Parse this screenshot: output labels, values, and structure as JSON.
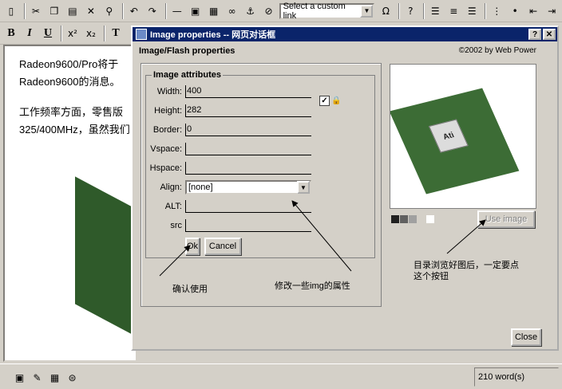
{
  "toolbar1": {
    "link_select_value": "Select a custom link",
    "icons": [
      "new-document-icon",
      "cut-icon",
      "copy-icon",
      "paste-icon",
      "delete-icon",
      "find-icon",
      "undo-icon",
      "redo-icon",
      "horizontal-rule-icon",
      "insert-image-icon",
      "insert-page-icon",
      "link-icon",
      "anchor-icon",
      "unlink-icon",
      "omega-icon",
      "help-icon",
      "align-left-icon",
      "align-center-icon",
      "align-right-icon",
      "ordered-list-icon",
      "unordered-list-icon",
      "outdent-icon",
      "indent-icon"
    ],
    "omega_glyph": "Ω",
    "help_glyph": "?"
  },
  "toolbar2": {
    "bold": "B",
    "italic": "I",
    "underline": "U",
    "superscript": "x²",
    "subscript": "x₂",
    "text_color": "T"
  },
  "editor": {
    "line1": "Radeon9600/Pro将于",
    "line2": "Radeon9600的消息。",
    "line3": "工作频率方面，零售版",
    "line4": "325/400MHz，虽然我们"
  },
  "statusbar": {
    "word_count": "210 word(s)"
  },
  "dialog": {
    "title": "Image properties -- 网页对话框",
    "help_btn": "?",
    "close_x": "✕",
    "section_title": "Image/Flash properties",
    "copyright": "©2002 by Web Power",
    "attributes_legend": "Image attributes",
    "fields": {
      "width_label": "Width:",
      "width_value": "400",
      "height_label": "Height:",
      "height_value": "282",
      "border_label": "Border:",
      "border_value": "0",
      "vspace_label": "Vspace:",
      "vspace_value": "",
      "hspace_label": "Hspace:",
      "hspace_value": "",
      "align_label": "Align:",
      "align_value": "[none]",
      "alt_label": "ALT:",
      "alt_value": "",
      "src_label": "src",
      "src_value": ""
    },
    "ok_label": "Ok",
    "cancel_label": "Cancel",
    "use_image_label": "Use image",
    "close_label": "Close",
    "chip_logo": "Ati",
    "constrain_checked": true
  },
  "annotations": {
    "confirm_use": "确认使用",
    "modify_attrs": "修改一些img的属性",
    "after_browse_line1": "目录浏览好图后，一定要点",
    "after_browse_line2": "这个按钮"
  },
  "colors": {
    "titlebar": "#0a246a",
    "chrome": "#d4d0c8",
    "chip_green": "#3c6c35"
  }
}
